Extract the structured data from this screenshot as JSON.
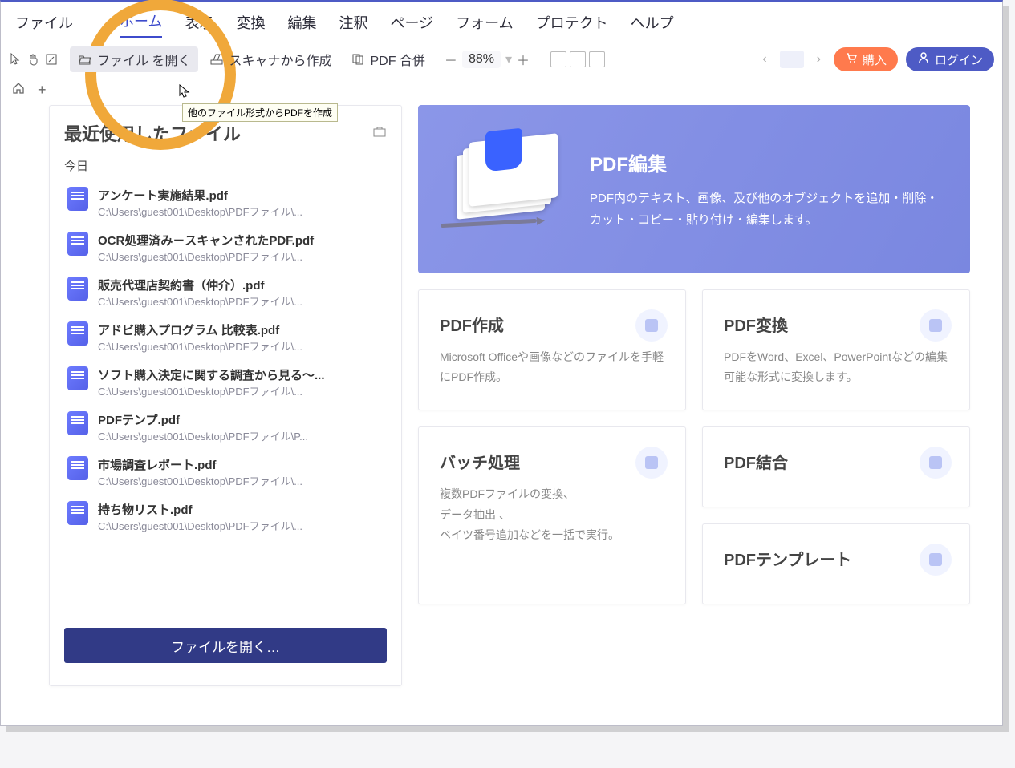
{
  "menu": {
    "file": "ファイル",
    "tabs": [
      "ホーム",
      "表示",
      "変換",
      "編集",
      "注釈",
      "ページ",
      "フォーム",
      "プロテクト",
      "ヘルプ"
    ],
    "active_index": 0
  },
  "toolbar": {
    "open_label": "ファイル を開く",
    "scan_label": "スキャナから作成",
    "merge_label": "PDF 合併",
    "zoom_minus": "－",
    "zoom_value": "88%",
    "zoom_plus": "＋",
    "buy_label": "購入",
    "login_label": "ログイン"
  },
  "tooltip": "他のファイル形式からPDFを作成",
  "recent": {
    "title": "最近使用したファイル",
    "today_label": "今日",
    "open_button": "ファイルを開く…",
    "files": [
      {
        "name": "アンケート実施結果.pdf",
        "path": "C:\\Users\\guest001\\Desktop\\PDFファイル\\..."
      },
      {
        "name": "OCR処理済み－スキャンされたPDF.pdf",
        "path": "C:\\Users\\guest001\\Desktop\\PDFファイル\\..."
      },
      {
        "name": "販売代理店契約書（仲介）.pdf",
        "path": "C:\\Users\\guest001\\Desktop\\PDFファイル\\..."
      },
      {
        "name": "アドビ購入プログラム 比較表.pdf",
        "path": "C:\\Users\\guest001\\Desktop\\PDFファイル\\..."
      },
      {
        "name": "ソフト購入決定に関する調査から見る～...",
        "path": "C:\\Users\\guest001\\Desktop\\PDFファイル\\..."
      },
      {
        "name": "PDFテンプ.pdf",
        "path": "C:\\Users\\guest001\\Desktop\\PDFファイル\\P..."
      },
      {
        "name": "市場調査レポート.pdf",
        "path": "C:\\Users\\guest001\\Desktop\\PDFファイル\\..."
      },
      {
        "name": "持ち物リスト.pdf",
        "path": "C:\\Users\\guest001\\Desktop\\PDFファイル\\..."
      }
    ]
  },
  "hero": {
    "title": "PDF編集",
    "desc": "PDF内のテキスト、画像、及び他のオブジェクトを追加・削除・カット・コピー・貼り付け・編集します。"
  },
  "cards": {
    "create": {
      "title": "PDF作成",
      "desc": "Microsoft Officeや画像などのファイルを手軽にPDF作成。"
    },
    "convert": {
      "title": "PDF変換",
      "desc": "PDFをWord、Excel、PowerPointなどの編集可能な形式に変換します。"
    },
    "batch": {
      "title": "バッチ処理",
      "desc": "複数PDFファイルの変換、\nデータ抽出 、\nベイツ番号追加などを一括で実行。"
    },
    "combine": {
      "title": "PDF結合",
      "desc": ""
    },
    "template": {
      "title": "PDFテンプレート",
      "desc": ""
    }
  }
}
